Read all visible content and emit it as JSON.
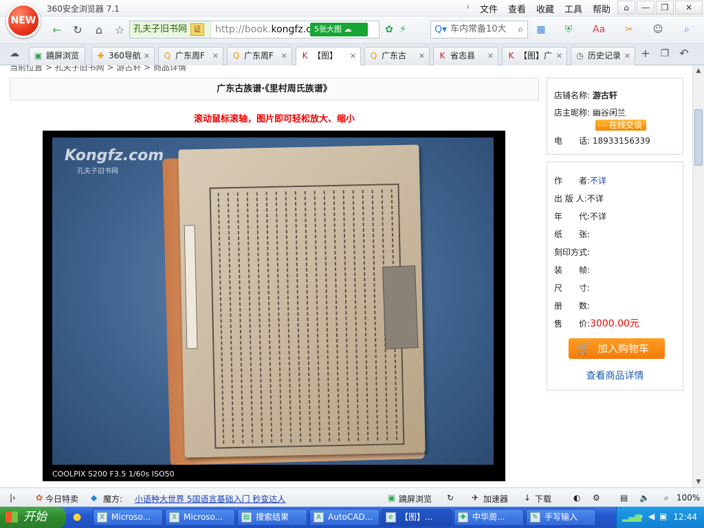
{
  "window": {
    "title": "360安全浏览器 7.1",
    "logo_text": "NEW",
    "menu": [
      "文件",
      "查看",
      "收藏",
      "工具",
      "帮助"
    ],
    "controls": [
      "⌂",
      "—",
      "❐",
      "✕"
    ]
  },
  "address_bar": {
    "site_tag": "孔夫子旧书网",
    "cert_badge": "证",
    "url_prefix": "http://book.",
    "url_domain": "kongfz.co",
    "image_button": "5张大图",
    "search_text": "车内常备10大"
  },
  "tabs": [
    {
      "label": "蹺屏浏览",
      "icon": "screen-icon"
    },
    {
      "label": "360导航",
      "icon": "nav-icon"
    },
    {
      "label": "广东周F",
      "icon": "search-icon"
    },
    {
      "label": "广东周F",
      "icon": "search-icon"
    },
    {
      "label": "【图】",
      "icon": "kongfz-icon"
    },
    {
      "label": "广东古",
      "icon": "search-icon"
    },
    {
      "label": "省志县",
      "icon": "kongfz-icon"
    },
    {
      "label": "【图】广",
      "icon": "kongfz-icon"
    },
    {
      "label": "历史记录",
      "icon": "history-icon"
    }
  ],
  "page": {
    "breadcrumb": "当前位置 > 孔夫子旧书网 > 游古轩 > 商品详情",
    "title": "广东古族谱·《里村周氏族谱》",
    "hint": "滚动鼠标滚轴，图片即可轻松放大、缩小",
    "watermark": "Kongfz.com",
    "watermark_sub": "孔夫子旧书网",
    "exif": "COOLPIX S200 F3.5 1/60s ISO50"
  },
  "shop": {
    "name_label": "店铺名称:",
    "name": "游古轩",
    "owner_label": "店主昵称:",
    "owner": "幽谷闲兰",
    "chat_button": "在线交谈",
    "phone_label": "电　　话:",
    "phone": "18933156339"
  },
  "details": {
    "author_label": "作　　者:",
    "author": "不详",
    "publisher_label": "出 版 人:",
    "publisher": "不详",
    "era_label": "年　　代:",
    "era": "不详",
    "paper_label": "纸　　张:",
    "paper": "",
    "printing_label": "刻印方式:",
    "printing": "",
    "binding_label": "装　　帧:",
    "binding": "",
    "size_label": "尺　　寸:",
    "size": "",
    "volumes_label": "册　　数:",
    "volumes": "",
    "price_label": "售　　价:",
    "price": "3000.00元",
    "cart_button": "加入购物车",
    "detail_link": "查看商品详情"
  },
  "status_bar": {
    "deals": "今日特卖",
    "mofang": "魔方:",
    "promo": "小语种大世界 5国语言基础入门 秒变达人",
    "screen": "蹺屏浏览",
    "accelerator": "加速器",
    "download": "下载",
    "zoom": "100%"
  },
  "taskbar": {
    "start": "开始",
    "items": [
      "Microso...",
      "Microso...",
      "搜索结果",
      "AutoCAD...",
      "【图】...",
      "中华周...",
      "手写输入"
    ],
    "clock": "12:44"
  },
  "colors": {
    "accent_green": "#19a536",
    "price_red": "#ee0000",
    "cart_orange": "#f47a0a",
    "link_blue": "#1b5ca8"
  }
}
